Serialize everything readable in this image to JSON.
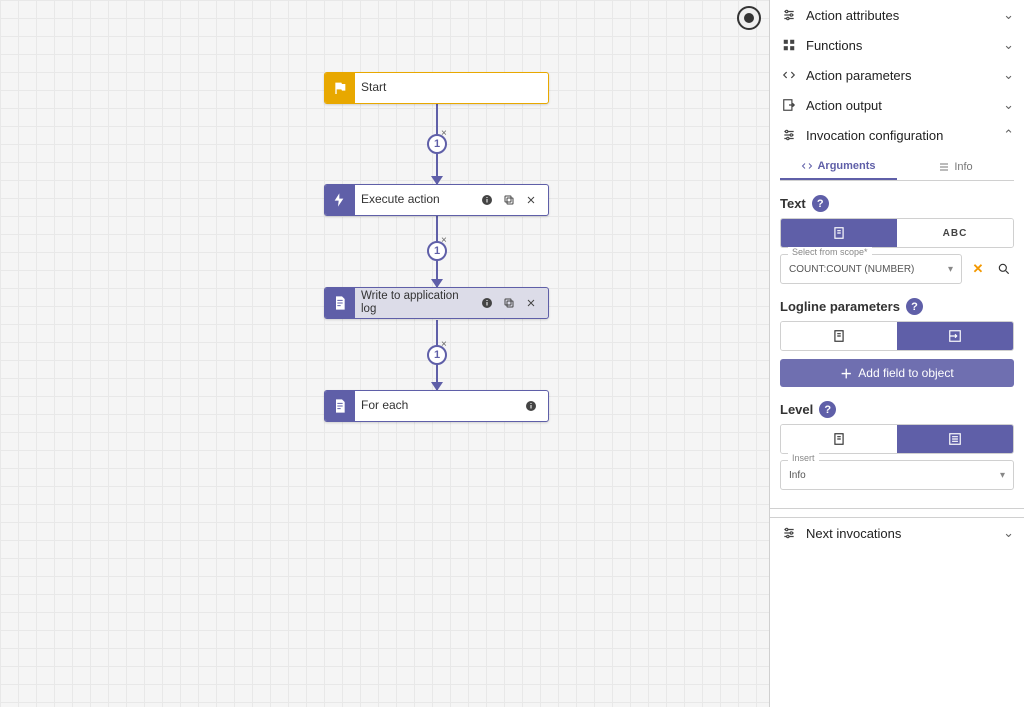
{
  "nodes": {
    "start": {
      "title": "Start"
    },
    "execute": {
      "title": "Execute action"
    },
    "writelog": {
      "title": "Write to application log"
    },
    "foreach": {
      "title": "For each"
    }
  },
  "connectors": {
    "c1": {
      "label": "1",
      "glyph": "×"
    },
    "c2": {
      "label": "1",
      "glyph": "×"
    },
    "c3": {
      "label": "1",
      "glyph": "×"
    }
  },
  "panel": {
    "sections": {
      "attributes": "Action attributes",
      "functions": "Functions",
      "parameters": "Action parameters",
      "output": "Action output",
      "invocation": "Invocation configuration",
      "next": "Next invocations"
    },
    "tabs": {
      "arguments": "Arguments",
      "info": "Info"
    },
    "text": {
      "label": "Text",
      "toggle_abc": "ABC",
      "select_float": "Select from scope*",
      "select_value": "COUNT:COUNT (NUMBER)"
    },
    "logline": {
      "label": "Logline parameters",
      "add_field": "Add field to object"
    },
    "level": {
      "label": "Level",
      "insert_float": "Insert",
      "insert_value": "Info"
    }
  }
}
